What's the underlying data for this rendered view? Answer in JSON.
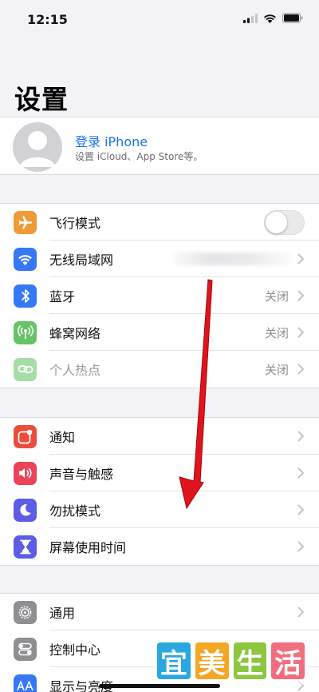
{
  "status": {
    "time": "12:15"
  },
  "page": {
    "title": "设置"
  },
  "profile": {
    "title": "登录 iPhone",
    "subtitle": "设置 iCloud、App Store等。"
  },
  "groups": [
    {
      "items": [
        {
          "label": "飞行模式",
          "icon": "airplane-icon",
          "color": "#f09a37",
          "control": "toggle",
          "on": false
        },
        {
          "label": "无线局域网",
          "icon": "wifi-icon",
          "color": "#3478f6",
          "value": ""
        },
        {
          "label": "蓝牙",
          "icon": "bluetooth-icon",
          "color": "#3478f6",
          "value": "关闭"
        },
        {
          "label": "蜂窝网络",
          "icon": "cellular-icon",
          "color": "#65c466",
          "value": "关闭"
        },
        {
          "label": "个人热点",
          "icon": "hotspot-icon",
          "color": "#a5dca8",
          "value": "关闭",
          "dimmed": true
        }
      ]
    },
    {
      "items": [
        {
          "label": "通知",
          "icon": "notifications-icon",
          "color": "#eb4d3d"
        },
        {
          "label": "声音与触感",
          "icon": "sounds-icon",
          "color": "#eb445a"
        },
        {
          "label": "勿扰模式",
          "icon": "moon-icon",
          "color": "#5e5ce6"
        },
        {
          "label": "屏幕使用时间",
          "icon": "hourglass-icon",
          "color": "#5e5ce6"
        }
      ]
    },
    {
      "items": [
        {
          "label": "通用",
          "icon": "gear-icon",
          "color": "#8e8e93"
        },
        {
          "label": "控制中心",
          "icon": "control-center-icon",
          "color": "#8e8e93"
        },
        {
          "label": "显示与亮度",
          "icon": "display-icon",
          "color": "#3478f6"
        }
      ]
    }
  ],
  "watermark": {
    "chars": [
      "宜",
      "美",
      "生",
      "活"
    ],
    "colors": [
      "#2aa7e0",
      "#f5a623",
      "#8dc63f",
      "#f26d7d"
    ]
  }
}
